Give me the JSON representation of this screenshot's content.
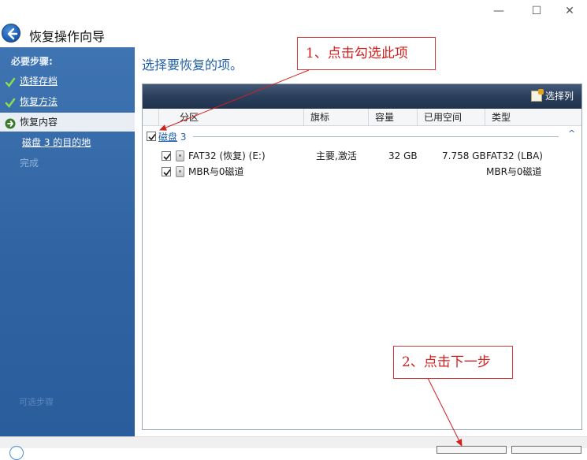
{
  "window": {
    "title": "恢复操作向导",
    "min_glyph": "—",
    "max_glyph": "☐",
    "close_glyph": "✕"
  },
  "sidebar": {
    "header": "必要步骤:",
    "steps": [
      {
        "label": "选择存档",
        "state": "done"
      },
      {
        "label": "恢复方法",
        "state": "done"
      },
      {
        "label": "恢复内容",
        "state": "current"
      },
      {
        "label": "磁盘 3 的目的地",
        "state": "pending"
      },
      {
        "label": "完成",
        "state": "disabled"
      }
    ],
    "footer": "可选步骤"
  },
  "main": {
    "heading": "选择要恢复的项。",
    "choose_columns": "选择列",
    "columns": [
      "分区",
      "旗标",
      "容量",
      "已用空间",
      "类型"
    ],
    "group": {
      "name": "磁盘",
      "number": "3",
      "checked": true,
      "collapse_glyph": "^"
    },
    "rows": [
      {
        "partition": "FAT32 (恢复) (E:)",
        "flags": "主要,激活",
        "capacity": "32 GB",
        "used": "7.758 GB",
        "type": "FAT32 (LBA)",
        "checked": true
      },
      {
        "partition": "MBR与0磁道",
        "flags": "",
        "capacity": "",
        "used": "",
        "type": "MBR与0磁道",
        "checked": true
      }
    ]
  },
  "annotations": {
    "step1": "1、点击勾选此项",
    "step2": "2、点击下一步"
  },
  "colors": {
    "sidebar": "#2f63a2",
    "heading": "#1f5fa8",
    "annotation": "#d21f1f",
    "panel_header": "#2b3f5c"
  }
}
